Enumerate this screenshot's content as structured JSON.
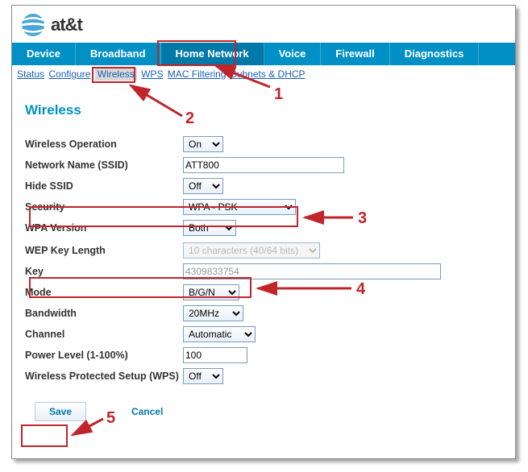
{
  "brand": {
    "name": "at&t"
  },
  "nav": [
    "Device",
    "Broadband",
    "Home Network",
    "Voice",
    "Firewall",
    "Diagnostics"
  ],
  "nav_active_index": 2,
  "subnav": {
    "items": [
      "Status",
      "Configure",
      "Wireless",
      "WPS",
      "MAC Filtering",
      "Subnets & DHCP"
    ],
    "selected_index": 2
  },
  "section_title": "Wireless",
  "fields": {
    "wireless_op": {
      "label": "Wireless Operation",
      "value": "On"
    },
    "ssid": {
      "label": "Network Name (SSID)",
      "value": "ATT800"
    },
    "hide_ssid": {
      "label": "Hide SSID",
      "value": "Off"
    },
    "security": {
      "label": "Security",
      "value": "WPA - PSK"
    },
    "wpa_version": {
      "label": "WPA Version",
      "value": "Both"
    },
    "wep_len": {
      "label": "WEP Key Length",
      "value": "10 characters (40/64 bits)"
    },
    "key": {
      "label": "Key",
      "value": "4309833754"
    },
    "mode": {
      "label": "Mode",
      "value": "B/G/N"
    },
    "bandwidth": {
      "label": "Bandwidth",
      "value": "20MHz"
    },
    "channel": {
      "label": "Channel",
      "value": "Automatic"
    },
    "power": {
      "label": "Power Level (1-100%)",
      "value": "100"
    },
    "wps": {
      "label": "Wireless Protected Setup (WPS)",
      "value": "Off"
    }
  },
  "buttons": {
    "save": "Save",
    "cancel": "Cancel"
  },
  "annotations": {
    "n1": "1",
    "n2": "2",
    "n3": "3",
    "n4": "4",
    "n5": "5"
  }
}
